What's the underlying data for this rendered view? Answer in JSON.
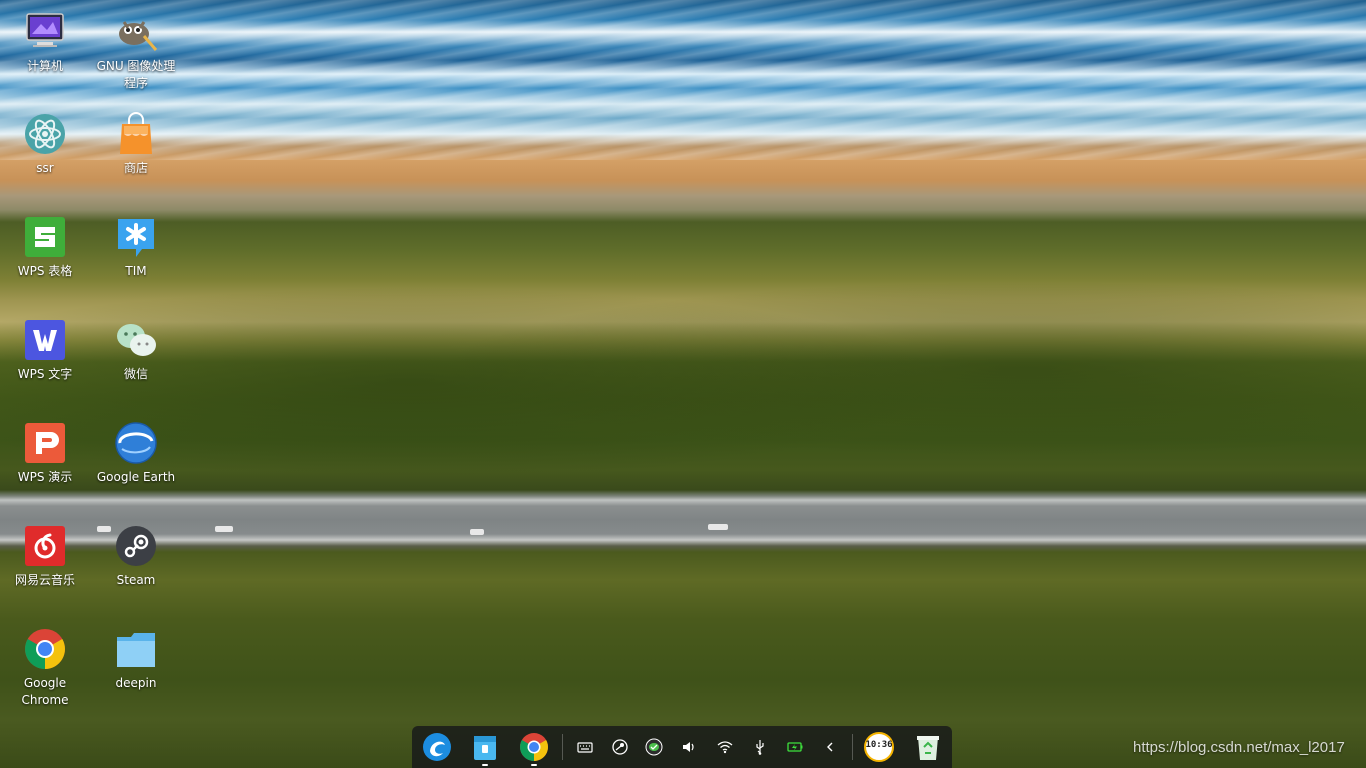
{
  "desktop": {
    "icons": [
      {
        "label": "计算机"
      },
      {
        "label": "GNU 图像处理程序"
      },
      {
        "label": "ssr"
      },
      {
        "label": "商店"
      },
      {
        "label": "WPS 表格"
      },
      {
        "label": "TIM"
      },
      {
        "label": "WPS 文字"
      },
      {
        "label": "微信"
      },
      {
        "label": "WPS 演示"
      },
      {
        "label": "Google Earth"
      },
      {
        "label": "网易云音乐"
      },
      {
        "label": "Steam"
      },
      {
        "label": "Google Chrome"
      },
      {
        "label": "deepin"
      }
    ]
  },
  "dock": {
    "apps": [
      "launcher-icon",
      "files-icon",
      "chrome-icon"
    ],
    "tray": [
      "keyboard-icon",
      "steam-tray-icon",
      "wechat-tray-icon",
      "volume-icon",
      "wifi-icon",
      "usb-icon",
      "battery-icon",
      "expand-arrow-icon"
    ],
    "clock": "10:36",
    "trash": "trash-icon"
  },
  "watermark": "https://blog.csdn.net/max_l2017"
}
